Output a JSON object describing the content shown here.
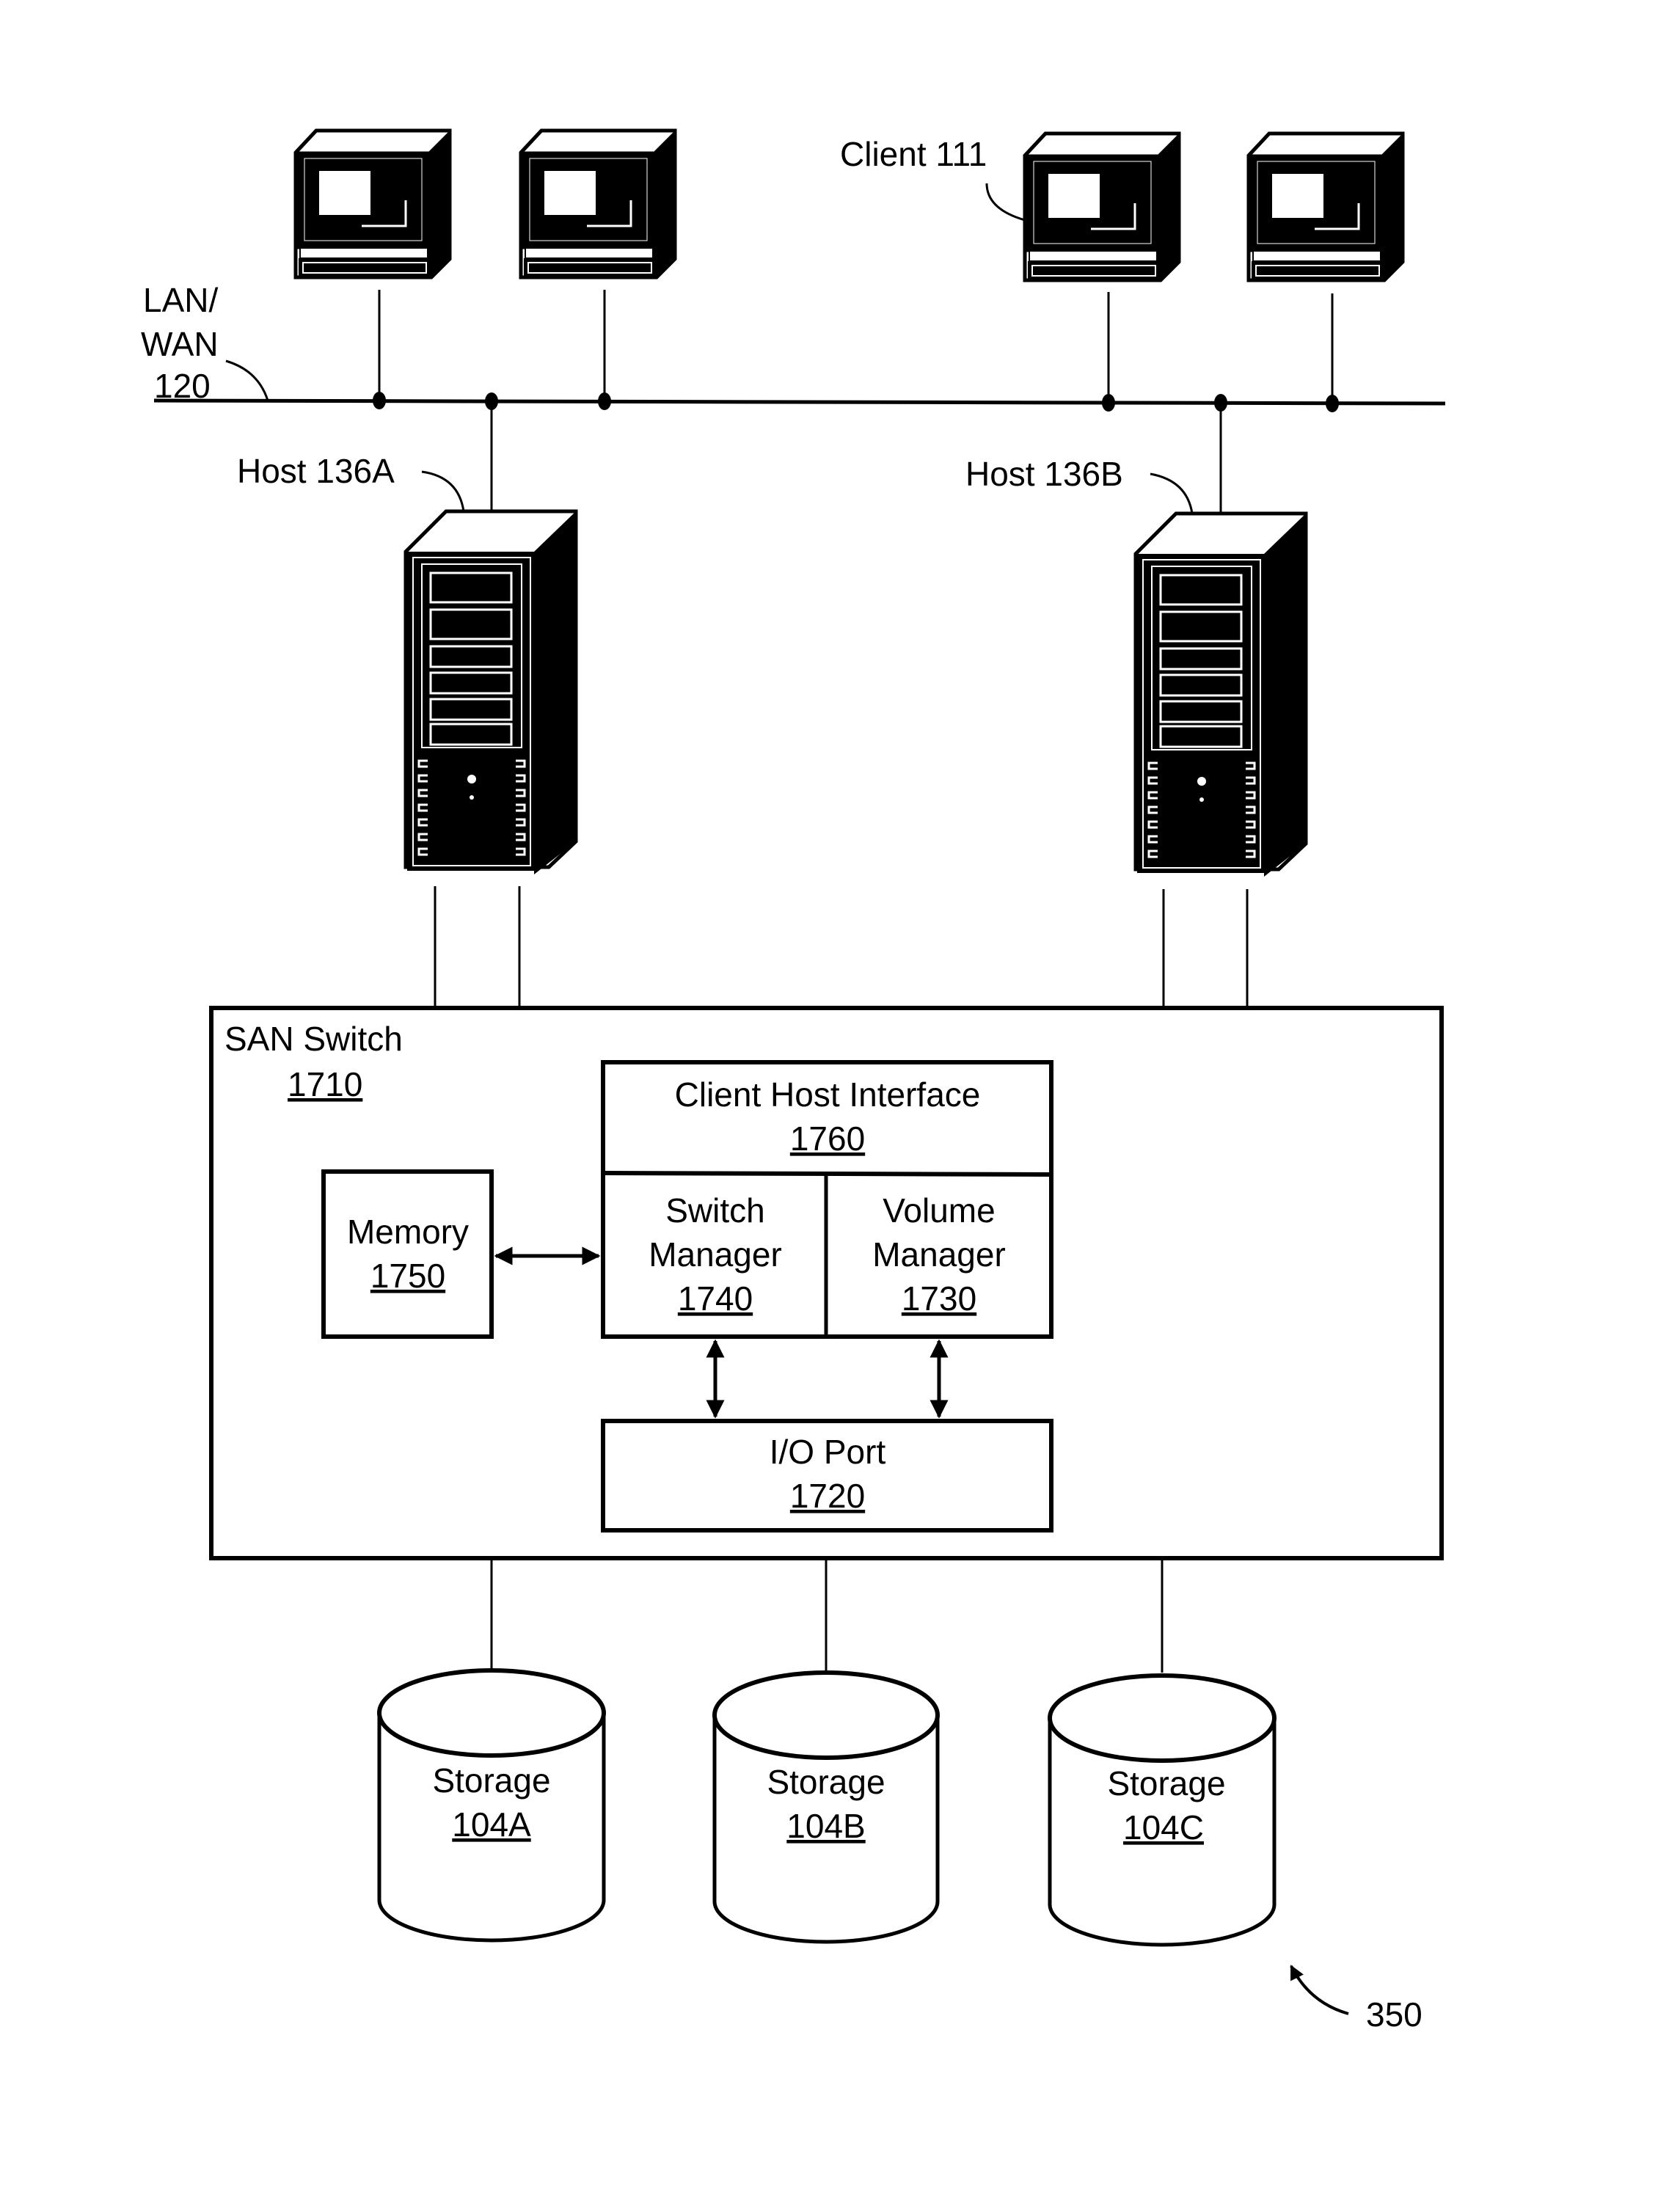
{
  "figure_ref": "350",
  "network": {
    "label_line1": "LAN/",
    "label_line2": "WAN",
    "label_ref": "120"
  },
  "clients": [
    {
      "label": ""
    },
    {
      "label": ""
    },
    {
      "label": "Client 111"
    },
    {
      "label": ""
    }
  ],
  "hosts": [
    {
      "label": "Host 136A"
    },
    {
      "label": "Host 136B"
    }
  ],
  "san_switch": {
    "title": "SAN Switch",
    "ref": "1710",
    "components": {
      "client_host_interface": {
        "title": "Client Host Interface",
        "ref": "1760"
      },
      "switch_manager": {
        "line1": "Switch",
        "line2": "Manager",
        "ref": "1740"
      },
      "volume_manager": {
        "line1": "Volume",
        "line2": "Manager",
        "ref": "1730"
      },
      "memory": {
        "title": "Memory",
        "ref": "1750"
      },
      "io_port": {
        "title": "I/O Port",
        "ref": "1720"
      }
    }
  },
  "storage": [
    {
      "title": "Storage",
      "ref": "104A"
    },
    {
      "title": "Storage",
      "ref": "104B"
    },
    {
      "title": "Storage",
      "ref": "104C"
    }
  ],
  "colors": {
    "ink": "#000000",
    "paper": "#ffffff"
  }
}
